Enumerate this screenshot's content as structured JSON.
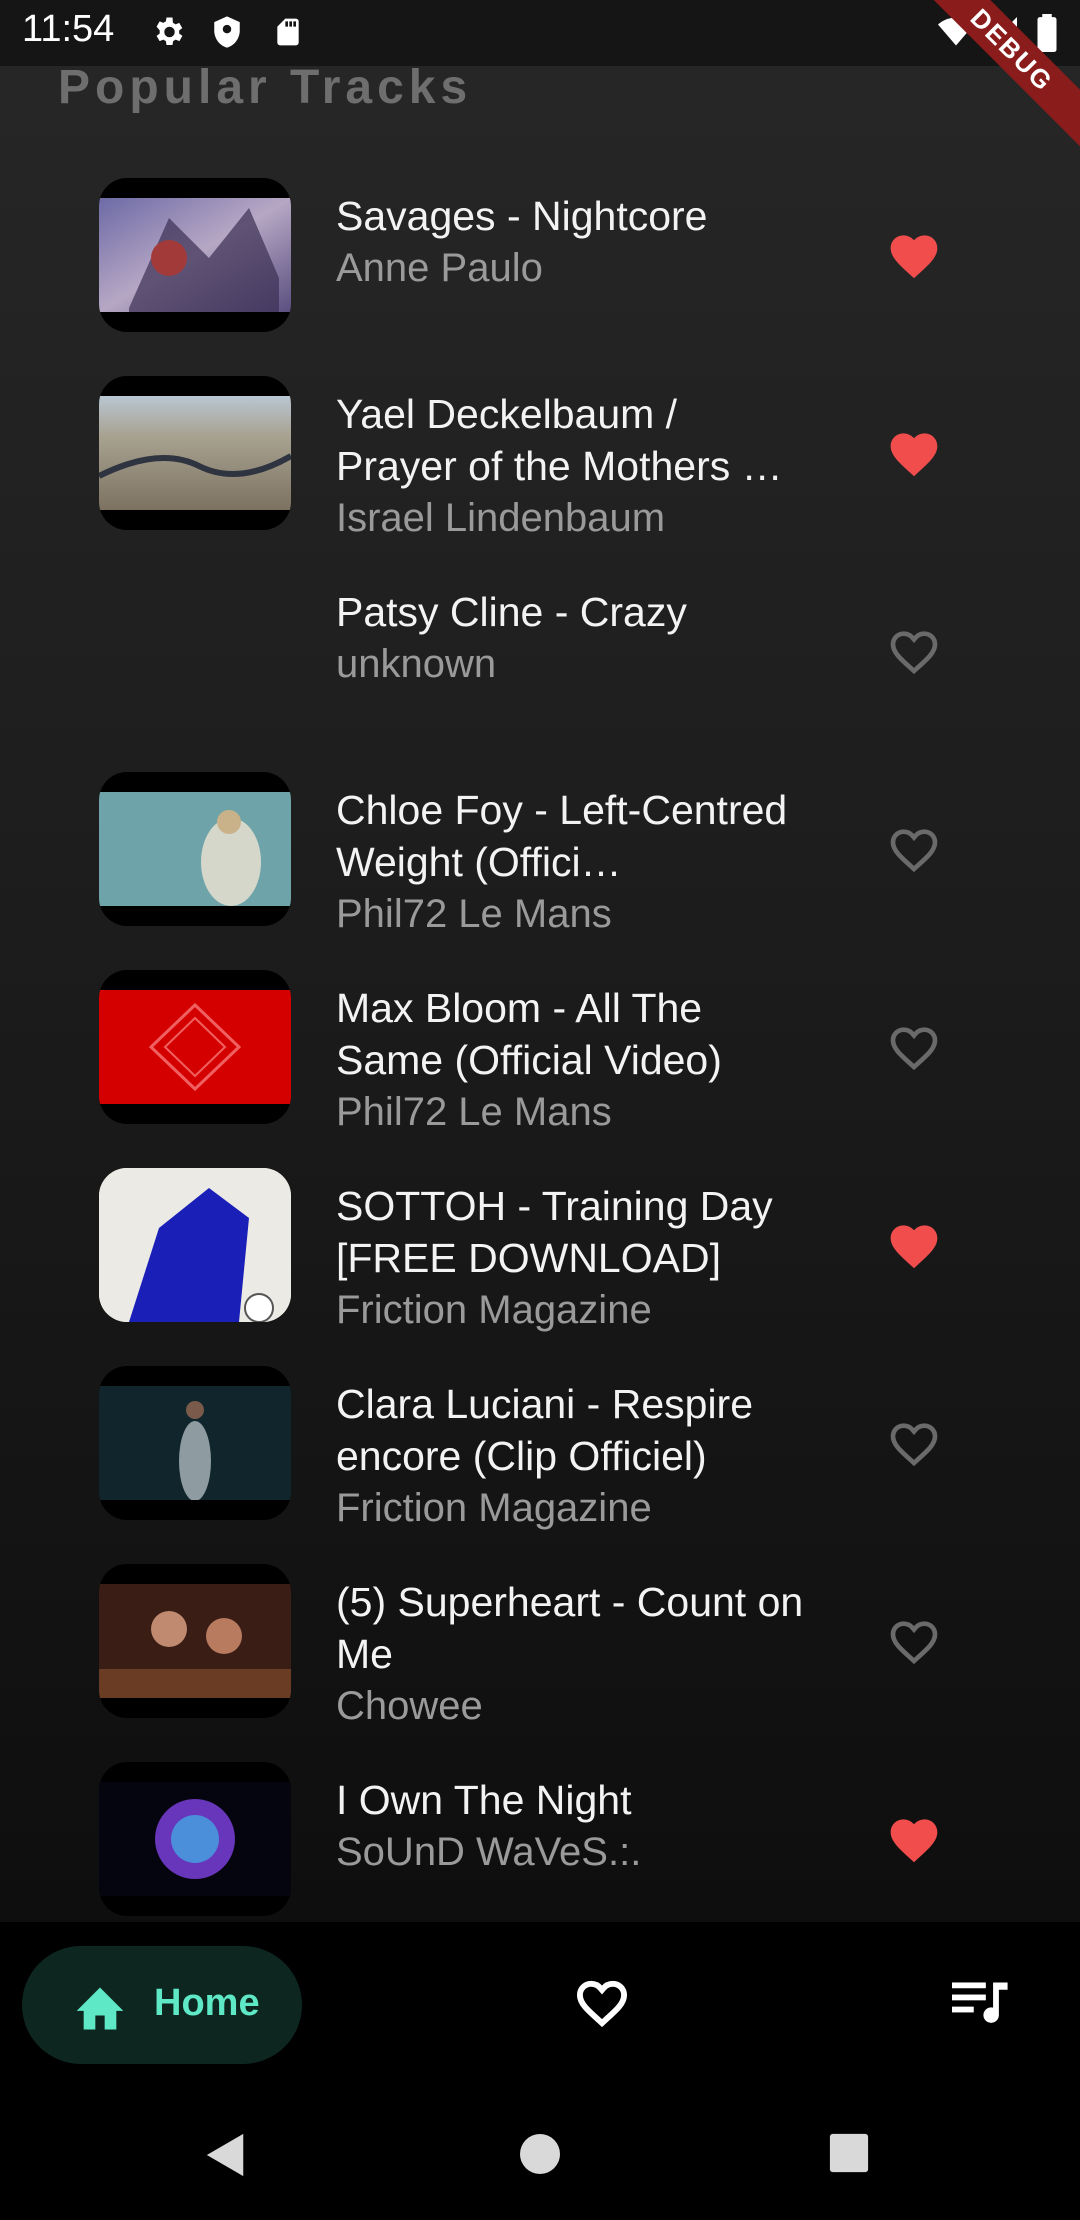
{
  "status_bar": {
    "time": "11:54",
    "icons": [
      "gear-icon",
      "shield-icon",
      "sd-card-icon",
      "wifi-icon",
      "signal-icon",
      "battery-icon"
    ],
    "debug_label": "DEBUG"
  },
  "section_title": "Popular Tracks",
  "colors": {
    "accent": "#5ee8c5",
    "heart_active": "#f24d4d",
    "heart_inactive": "#6a6a6a"
  },
  "tracks": [
    {
      "title": "Savages - Nightcore",
      "artist": "Anne Paulo",
      "liked": true
    },
    {
      "title": "Yael Deckelbaum / Prayer of the Mothers …",
      "artist": "Israel Lindenbaum",
      "liked": true
    },
    {
      "title": "Patsy Cline - Crazy",
      "artist": "unknown",
      "liked": false
    },
    {
      "title": "Chloe Foy - Left-Centred Weight (Offici…",
      "artist": "Phil72 Le Mans",
      "liked": false
    },
    {
      "title": "Max Bloom - All The Same (Official Video)",
      "artist": "Phil72 Le Mans",
      "liked": false
    },
    {
      "title": "SOTTOH - Training Day [FREE DOWNLOAD]",
      "artist": "Friction Magazine",
      "liked": true
    },
    {
      "title": "Clara Luciani - Respire encore (Clip Officiel)",
      "artist": "Friction Magazine",
      "liked": false
    },
    {
      "title": "(5) Superheart - Count on Me",
      "artist": "Chowee",
      "liked": false
    },
    {
      "title": "I Own The Night",
      "artist": "SoUnD WaVeS.:.",
      "liked": true
    }
  ],
  "bottom_nav": {
    "home_label": "Home",
    "items": [
      "home-icon",
      "favorites-heart-icon",
      "queue-music-icon"
    ]
  }
}
